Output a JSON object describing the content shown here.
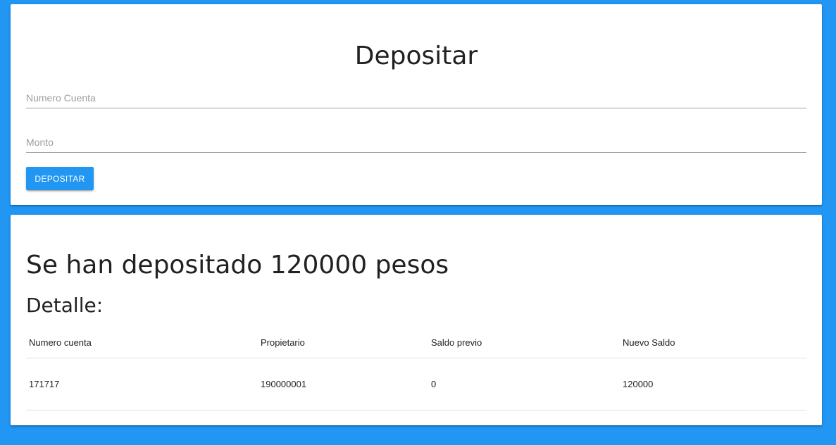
{
  "form": {
    "title": "Depositar",
    "account_placeholder": "Numero Cuenta",
    "amount_placeholder": "Monto",
    "submit_label": "DEPOSITAR"
  },
  "result": {
    "message": "Se han depositado 120000 pesos",
    "detail_title": "Detalle:",
    "columns": [
      "Numero cuenta",
      "Propietario",
      "Saldo previo",
      "Nuevo Saldo"
    ],
    "rows": [
      [
        "171717",
        "190000001",
        "0",
        "120000"
      ]
    ]
  },
  "colors": {
    "background": "#2196f3",
    "button": "#2196f3",
    "card": "#ffffff"
  }
}
